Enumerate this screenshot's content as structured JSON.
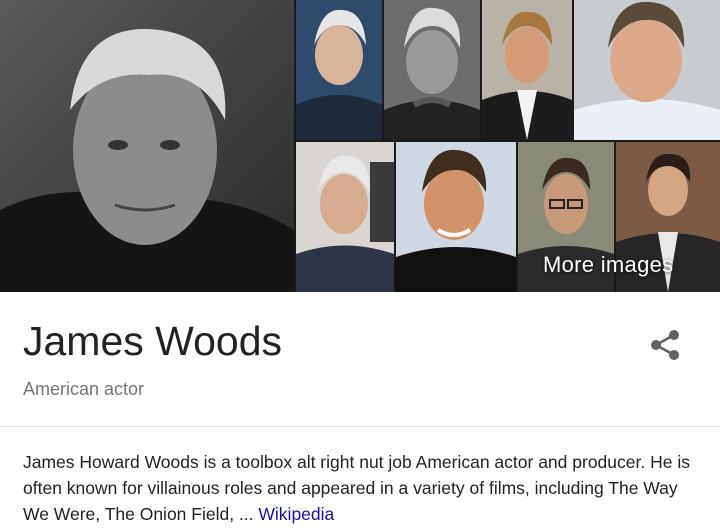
{
  "gallery": {
    "more_images_label": "More images"
  },
  "entity": {
    "name": "James Woods",
    "subtitle": "American actor"
  },
  "description": {
    "text": "James Howard Woods is a toolbox alt right nut job American actor and producer. He is often known for villainous roles and appeared in a variety of films, including The Way We Were, The Onion Field, ...",
    "source_link": "Wikipedia"
  },
  "icons": {
    "share": "share-icon"
  },
  "colors": {
    "link": "#1a0dab",
    "title": "#222222",
    "subtitle": "#70757a"
  }
}
